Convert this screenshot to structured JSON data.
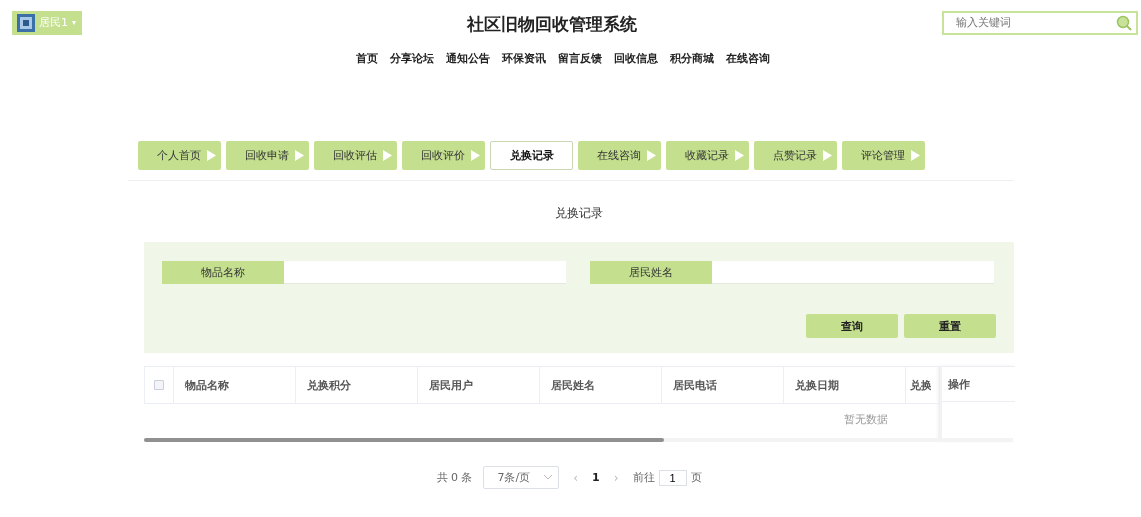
{
  "user_menu": {
    "label": "居民1",
    "caret": "▾"
  },
  "site_title": "社区旧物回收管理系统",
  "search": {
    "placeholder": "输入关键词"
  },
  "nav": [
    {
      "label": "首页"
    },
    {
      "label": "分享论坛"
    },
    {
      "label": "通知公告"
    },
    {
      "label": "环保资讯"
    },
    {
      "label": "留言反馈"
    },
    {
      "label": "回收信息"
    },
    {
      "label": "积分商城"
    },
    {
      "label": "在线咨询"
    }
  ],
  "tabs": [
    {
      "label": "个人首页",
      "selected": false
    },
    {
      "label": "回收申请",
      "selected": false
    },
    {
      "label": "回收评估",
      "selected": false
    },
    {
      "label": "回收评价",
      "selected": false
    },
    {
      "label": "兑换记录",
      "selected": true
    },
    {
      "label": "在线咨询",
      "selected": false
    },
    {
      "label": "收藏记录",
      "selected": false
    },
    {
      "label": "点赞记录",
      "selected": false
    },
    {
      "label": "评论管理",
      "selected": false
    }
  ],
  "page_title": "兑换记录",
  "filters": [
    {
      "label": "物品名称"
    },
    {
      "label": "居民姓名"
    }
  ],
  "buttons": [
    {
      "label": "查询"
    },
    {
      "label": "重置"
    }
  ],
  "table": {
    "select_all_checked": false,
    "columns": [
      "物品名称",
      "兑换积分",
      "居民用户",
      "居民姓名",
      "居民电话",
      "兑换日期",
      "兑换"
    ],
    "action_column": "操作",
    "empty_text": "暂无数据"
  },
  "pagination": {
    "total": "共 0 条",
    "page_size": "7条/页",
    "prev": "‹",
    "current": "1",
    "next": "›",
    "goto_label": "前往",
    "goto_value": "1",
    "page_suffix": "页"
  }
}
